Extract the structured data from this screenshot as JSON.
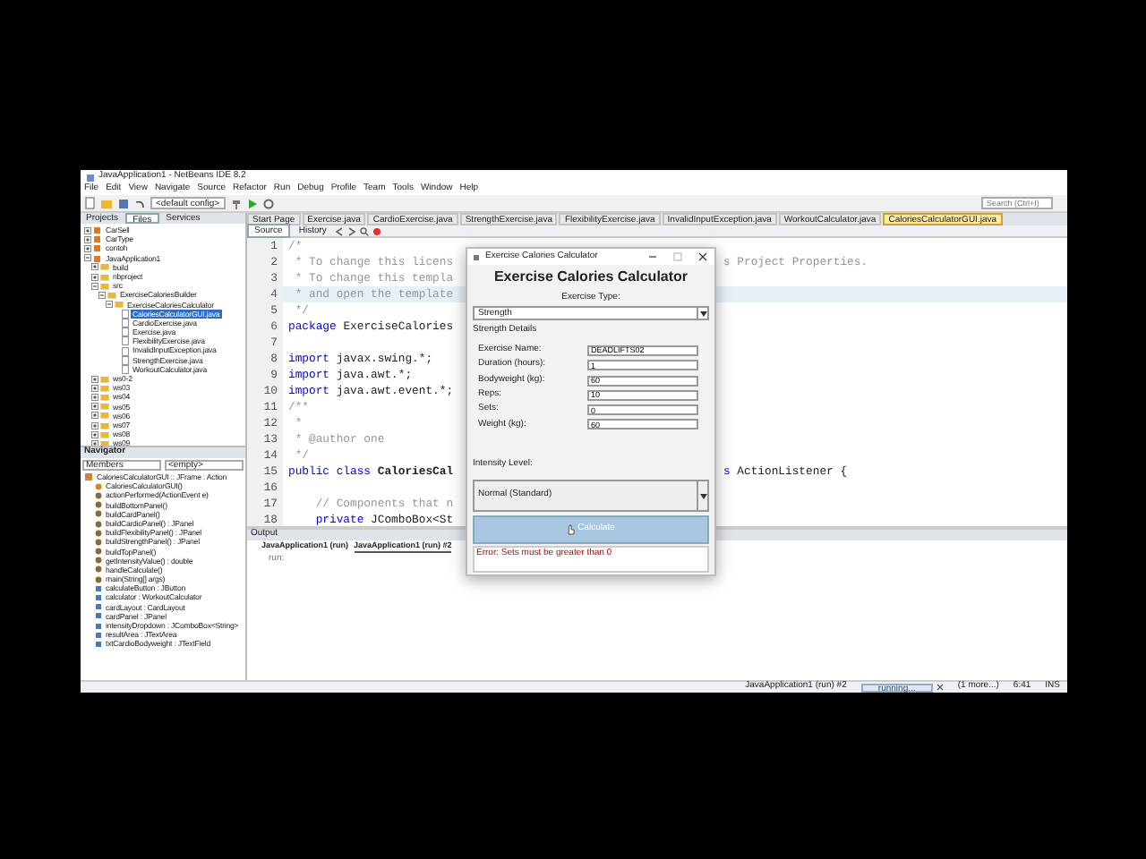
{
  "window": {
    "title": "JavaApplication1 - NetBeans IDE 8.2"
  },
  "menu": [
    "File",
    "Edit",
    "View",
    "Navigate",
    "Source",
    "Refactor",
    "Run",
    "Debug",
    "Profile",
    "Team",
    "Tools",
    "Window",
    "Help"
  ],
  "toolbar": {
    "config": "<default config>",
    "search_placeholder": "Search (Ctrl+I)"
  },
  "project_tabs": [
    {
      "label": "Projects",
      "selected": false
    },
    {
      "label": "Files",
      "selected": true
    },
    {
      "label": "Services",
      "selected": false
    }
  ],
  "project_tree": [
    {
      "label": "CarSell",
      "kind": "project",
      "expanded": false,
      "selected": false
    },
    {
      "label": "CarType",
      "kind": "project",
      "expanded": false,
      "selected": false
    },
    {
      "label": "contoh",
      "kind": "project",
      "expanded": false,
      "selected": false
    },
    {
      "label": "JavaApplication1",
      "kind": "project",
      "expanded": true,
      "selected": false,
      "children": [
        {
          "label": "build",
          "kind": "folder",
          "expanded": false,
          "selected": false
        },
        {
          "label": "nbproject",
          "kind": "folder",
          "expanded": false,
          "selected": false
        },
        {
          "label": "src",
          "kind": "folder",
          "expanded": true,
          "selected": false,
          "children": [
            {
              "label": "ExerciseCaloriesBuilder",
              "kind": "folder",
              "expanded": true,
              "selected": false,
              "children": [
                {
                  "label": "ExerciseCaloriesCalculator",
                  "kind": "folder",
                  "expanded": true,
                  "selected": false,
                  "children": [
                    {
                      "label": "CaloriesCalculatorGUI.java",
                      "kind": "file",
                      "selected": true
                    },
                    {
                      "label": "CardioExercise.java",
                      "kind": "file",
                      "selected": false
                    },
                    {
                      "label": "Exercise.java",
                      "kind": "file",
                      "selected": false
                    },
                    {
                      "label": "FlexibilityExercise.java",
                      "kind": "file",
                      "selected": false
                    },
                    {
                      "label": "InvalidInputException.java",
                      "kind": "file",
                      "selected": false
                    },
                    {
                      "label": "StrengthExercise.java",
                      "kind": "file",
                      "selected": false
                    },
                    {
                      "label": "WorkoutCalculator.java",
                      "kind": "file",
                      "selected": false
                    }
                  ]
                }
              ]
            }
          ]
        },
        {
          "label": "ws0-2",
          "kind": "folder",
          "expanded": false,
          "selected": false
        },
        {
          "label": "ws03",
          "kind": "folder",
          "expanded": false,
          "selected": false
        },
        {
          "label": "ws04",
          "kind": "folder",
          "expanded": false,
          "selected": false
        },
        {
          "label": "ws05",
          "kind": "folder",
          "expanded": false,
          "selected": false
        },
        {
          "label": "ws06",
          "kind": "folder",
          "expanded": false,
          "selected": false
        },
        {
          "label": "ws07",
          "kind": "folder",
          "expanded": false,
          "selected": false
        },
        {
          "label": "ws08",
          "kind": "folder",
          "expanded": false,
          "selected": false
        },
        {
          "label": "ws09",
          "kind": "folder",
          "expanded": false,
          "selected": false
        }
      ]
    }
  ],
  "editor_tabs": [
    {
      "label": "Start Page",
      "selected": false
    },
    {
      "label": "Exercise.java",
      "selected": false
    },
    {
      "label": "CardioExercise.java",
      "selected": false
    },
    {
      "label": "StrengthExercise.java",
      "selected": false
    },
    {
      "label": "FlexibilityExercise.java",
      "selected": false
    },
    {
      "label": "InvalidInputException.java",
      "selected": false
    },
    {
      "label": "WorkoutCalculator.java",
      "selected": false
    },
    {
      "label": "CaloriesCalculatorGUI.java",
      "selected": true
    }
  ],
  "editor_view_tabs": [
    {
      "label": "Source",
      "selected": true
    },
    {
      "label": "History",
      "selected": false
    }
  ],
  "code_lines": [
    {
      "number": "1",
      "highlighted": false,
      "segments": [
        {
          "kind": "comment",
          "text": "/*"
        }
      ]
    },
    {
      "number": "2",
      "highlighted": false,
      "segments": [
        {
          "kind": "comment",
          "text": " * To change this licens"
        }
      ],
      "right": [
        {
          "kind": "comment",
          "text": "s Project Properties."
        }
      ]
    },
    {
      "number": "3",
      "highlighted": false,
      "segments": [
        {
          "kind": "comment",
          "text": " * To change this templa"
        }
      ]
    },
    {
      "number": "4",
      "highlighted": true,
      "segments": [
        {
          "kind": "comment",
          "text": " * and open the template"
        }
      ]
    },
    {
      "number": "5",
      "highlighted": false,
      "segments": [
        {
          "kind": "comment",
          "text": " */"
        }
      ]
    },
    {
      "number": "6",
      "highlighted": false,
      "segments": [
        {
          "kind": "keyword",
          "text": "package "
        },
        {
          "kind": "plain",
          "text": "ExerciseCalories"
        }
      ]
    },
    {
      "number": "7",
      "highlighted": false
    },
    {
      "number": "8",
      "highlighted": false,
      "segments": [
        {
          "kind": "keyword",
          "text": "import "
        },
        {
          "kind": "plain",
          "text": "javax.swing.*;"
        }
      ]
    },
    {
      "number": "9",
      "highlighted": false,
      "segments": [
        {
          "kind": "keyword",
          "text": "import "
        },
        {
          "kind": "plain",
          "text": "java.awt.*;"
        }
      ]
    },
    {
      "number": "10",
      "highlighted": false,
      "segments": [
        {
          "kind": "keyword",
          "text": "import "
        },
        {
          "kind": "plain",
          "text": "java.awt.event.*;"
        }
      ]
    },
    {
      "number": "11",
      "highlighted": false,
      "segments": [
        {
          "kind": "comment",
          "text": "/**"
        }
      ]
    },
    {
      "number": "12",
      "highlighted": false,
      "segments": [
        {
          "kind": "comment",
          "text": " *"
        }
      ]
    },
    {
      "number": "13",
      "highlighted": false,
      "segments": [
        {
          "kind": "comment",
          "text": " * @author one"
        }
      ]
    },
    {
      "number": "14",
      "highlighted": false,
      "segments": [
        {
          "kind": "comment",
          "text": " */"
        }
      ]
    },
    {
      "number": "15",
      "highlighted": false,
      "segments": [
        {
          "kind": "keyword",
          "text": "public class "
        },
        {
          "kind": "bold",
          "text": "CaloriesCal"
        }
      ],
      "right": [
        {
          "kind": "keyword",
          "text": "s "
        },
        {
          "kind": "plain",
          "text": "ActionListener {"
        }
      ]
    },
    {
      "number": "16",
      "highlighted": false
    },
    {
      "number": "17",
      "highlighted": false,
      "segments": [
        {
          "kind": "comment",
          "text": "    // Components that n"
        }
      ]
    },
    {
      "number": "18",
      "highlighted": false,
      "segments": [
        {
          "kind": "keyword",
          "text": "    private "
        },
        {
          "kind": "plain",
          "text": "JComboBox<St"
        }
      ]
    }
  ],
  "navigator": {
    "title": "Navigator",
    "filter": "Members",
    "scope": "<empty>",
    "root": "CaloriesCalculatorGUI :: JFrame : Action",
    "members": [
      {
        "label": "CaloriesCalculatorGUI()",
        "kind": "constructor"
      },
      {
        "label": "actionPerformed(ActionEvent e)",
        "kind": "method"
      },
      {
        "label": "buildBottomPanel()",
        "kind": "method"
      },
      {
        "label": "buildCardPanel()",
        "kind": "method"
      },
      {
        "label": "buildCardioPanel() : JPanel",
        "kind": "method"
      },
      {
        "label": "buildFlexibilityPanel() : JPanel",
        "kind": "method"
      },
      {
        "label": "buildStrengthPanel() : JPanel",
        "kind": "method"
      },
      {
        "label": "buildTopPanel()",
        "kind": "method"
      },
      {
        "label": "getIntensityValue() : double",
        "kind": "method"
      },
      {
        "label": "handleCalculate()",
        "kind": "method"
      },
      {
        "label": "main(String[] args)",
        "kind": "method"
      },
      {
        "label": "calculateButton : JButton",
        "kind": "field"
      },
      {
        "label": "calculator : WorkoutCalculator",
        "kind": "field"
      },
      {
        "label": "cardLayout : CardLayout",
        "kind": "field"
      },
      {
        "label": "cardPanel : JPanel",
        "kind": "field"
      },
      {
        "label": "intensityDropdown : JComboBox<String>",
        "kind": "field"
      },
      {
        "label": "resultArea : JTextArea",
        "kind": "field"
      },
      {
        "label": "txtCardioBodyweight : JTextField",
        "kind": "field"
      }
    ]
  },
  "output": {
    "title": "Output",
    "tabs": [
      {
        "label": "JavaApplication1 (run)",
        "selected": false
      },
      {
        "label": "JavaApplication1 (run) #2",
        "selected": true
      }
    ],
    "lines": [
      "run:"
    ]
  },
  "status_bar": {
    "task": "JavaApplication1 (run) #2",
    "progress_text": "running...",
    "more": "(1 more...)",
    "position": "6:41",
    "mode": "INS"
  },
  "dialog": {
    "title": "Exercise Calories Calculator",
    "heading": "Exercise Calories Calculator",
    "type_label": "Exercise Type:",
    "type_value": "Strength",
    "group_title": "Strength Details",
    "fields": [
      {
        "label": "Exercise Name:",
        "value": "DEADLIFTS02"
      },
      {
        "label": "Duration (hours):",
        "value": "1"
      },
      {
        "label": "Bodyweight (kg):",
        "value": "60"
      },
      {
        "label": "Reps:",
        "value": "10"
      },
      {
        "label": "Sets:",
        "value": "0"
      },
      {
        "label": "Weight (kg):",
        "value": "60"
      }
    ],
    "intensity_label": "Intensity Level:",
    "intensity_value": "Normal (Standard)",
    "button": {
      "label": "Calculate",
      "hovered": true
    },
    "result": "Error: Sets must be greater than 0"
  }
}
